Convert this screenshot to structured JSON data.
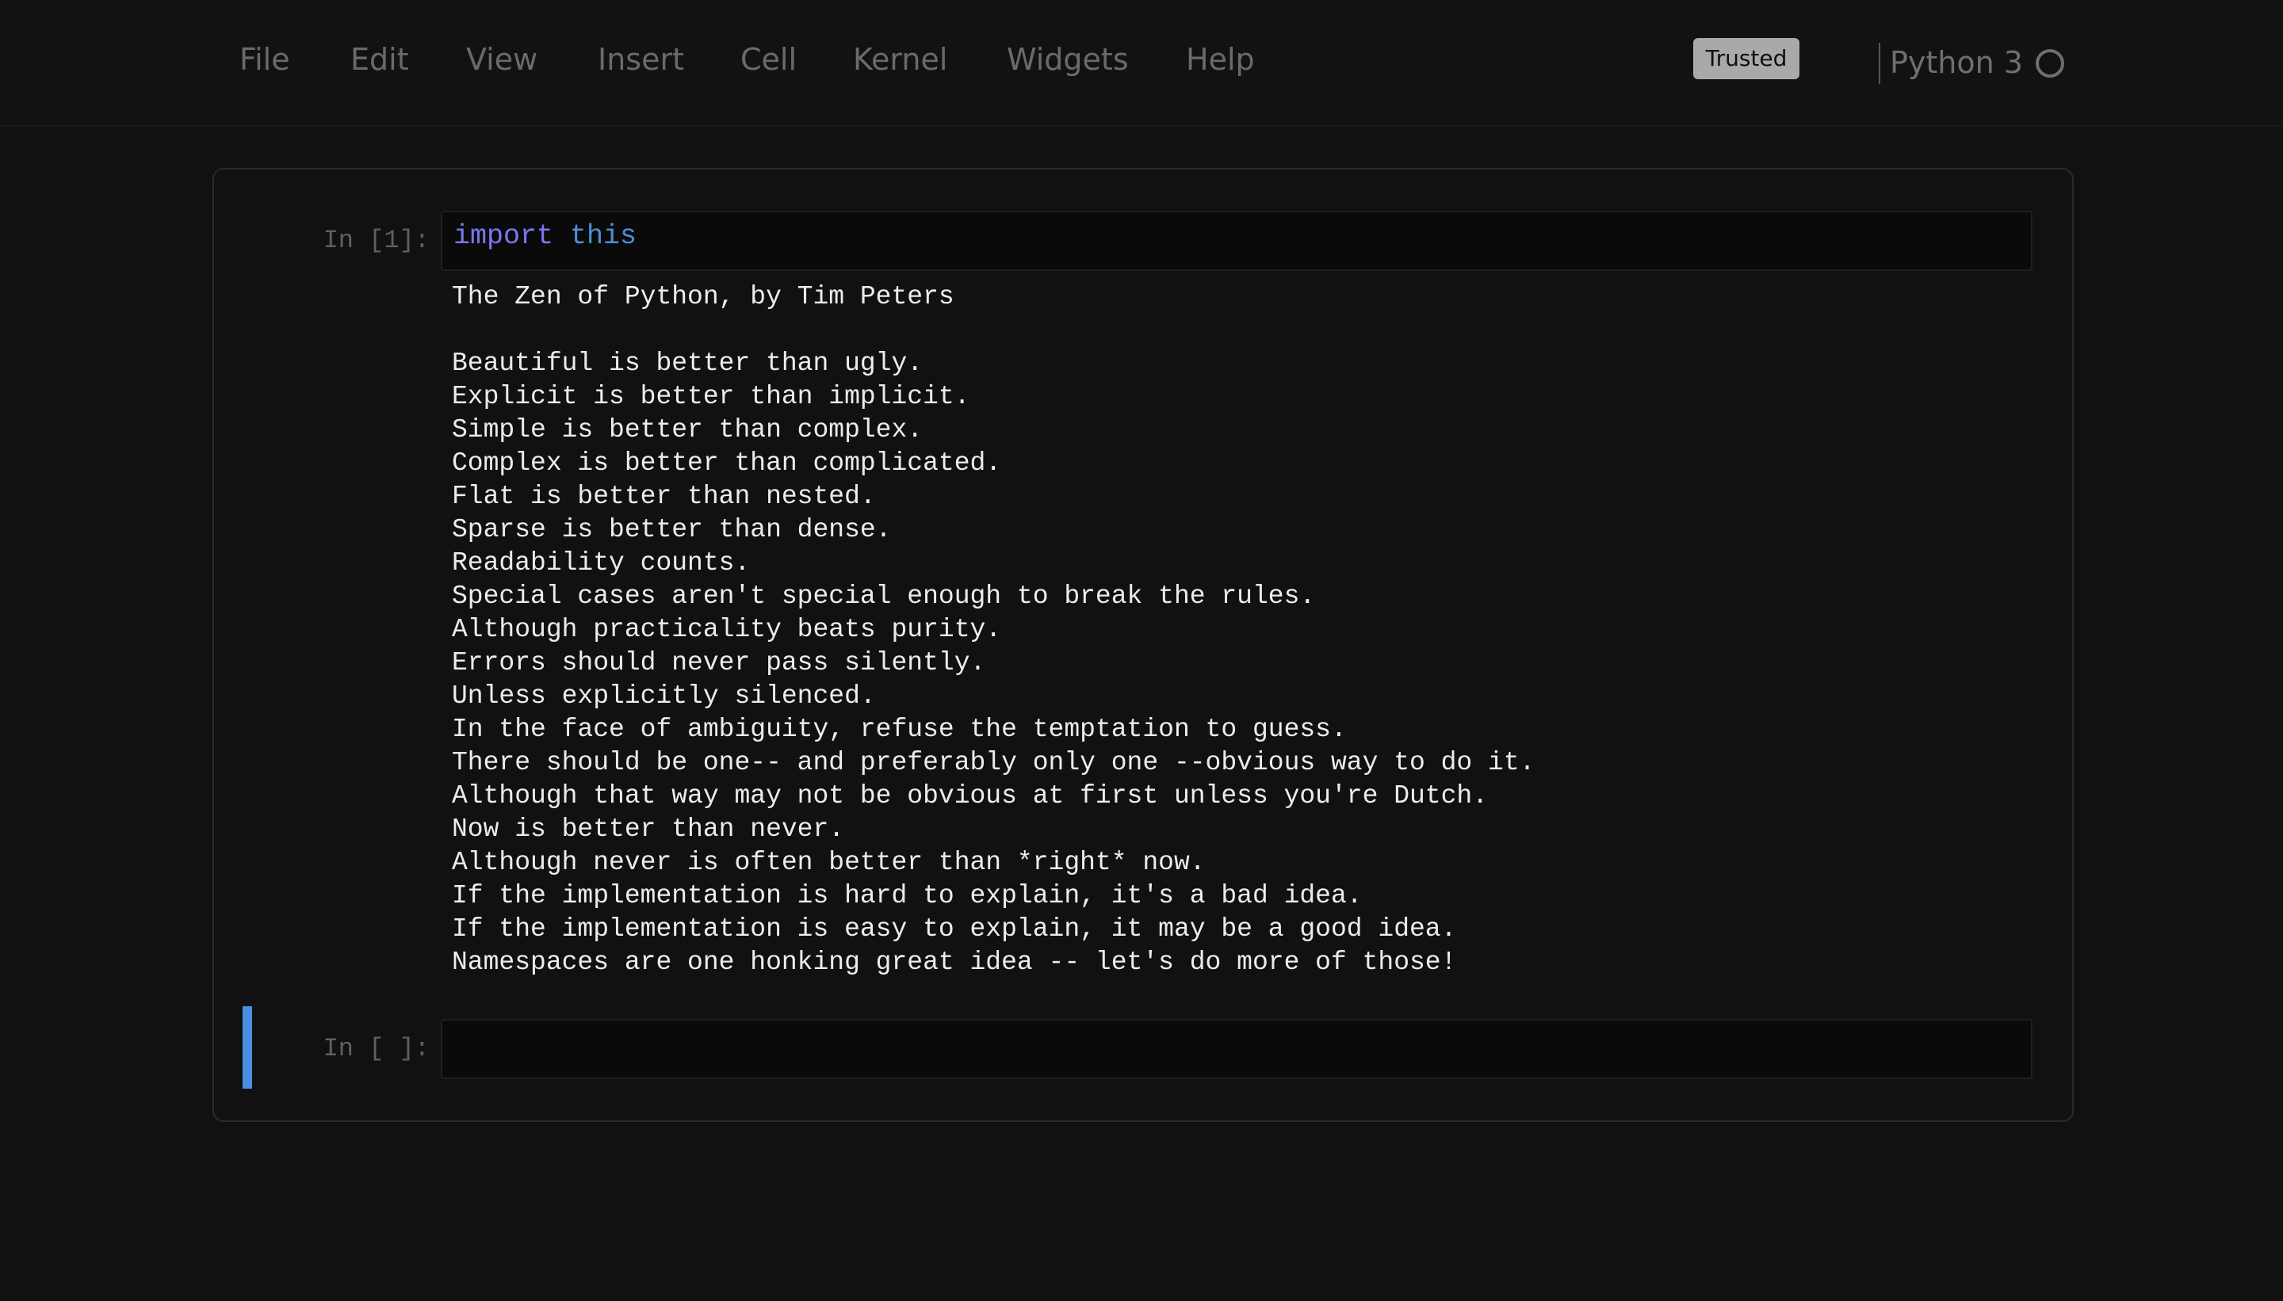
{
  "menubar": {
    "items": [
      "File",
      "Edit",
      "View",
      "Insert",
      "Cell",
      "Kernel",
      "Widgets",
      "Help"
    ],
    "trusted_label": "Trusted",
    "kernel_name": "Python 3",
    "kernel_status_icon": "kernel-idle-circle"
  },
  "cells": [
    {
      "prompt": "In [1]:",
      "code_keyword": "import",
      "code_module": "this",
      "output": [
        "The Zen of Python, by Tim Peters",
        "",
        "Beautiful is better than ugly.",
        "Explicit is better than implicit.",
        "Simple is better than complex.",
        "Complex is better than complicated.",
        "Flat is better than nested.",
        "Sparse is better than dense.",
        "Readability counts.",
        "Special cases aren't special enough to break the rules.",
        "Although practicality beats purity.",
        "Errors should never pass silently.",
        "Unless explicitly silenced.",
        "In the face of ambiguity, refuse the temptation to guess.",
        "There should be one-- and preferably only one --obvious way to do it.",
        "Although that way may not be obvious at first unless you're Dutch.",
        "Now is better than never.",
        "Although never is often better than *right* now.",
        "If the implementation is hard to explain, it's a bad idea.",
        "If the implementation is easy to explain, it may be a good idea.",
        "Namespaces are one honking great idea -- let's do more of those!"
      ]
    },
    {
      "prompt": "In [ ]:",
      "code": ""
    }
  ],
  "colors": {
    "background": "#111111",
    "keyword": "#7b77f0",
    "module": "#4b8fd6",
    "output_text": "#ececec",
    "selected_cell_bar": "#4a90e2"
  }
}
